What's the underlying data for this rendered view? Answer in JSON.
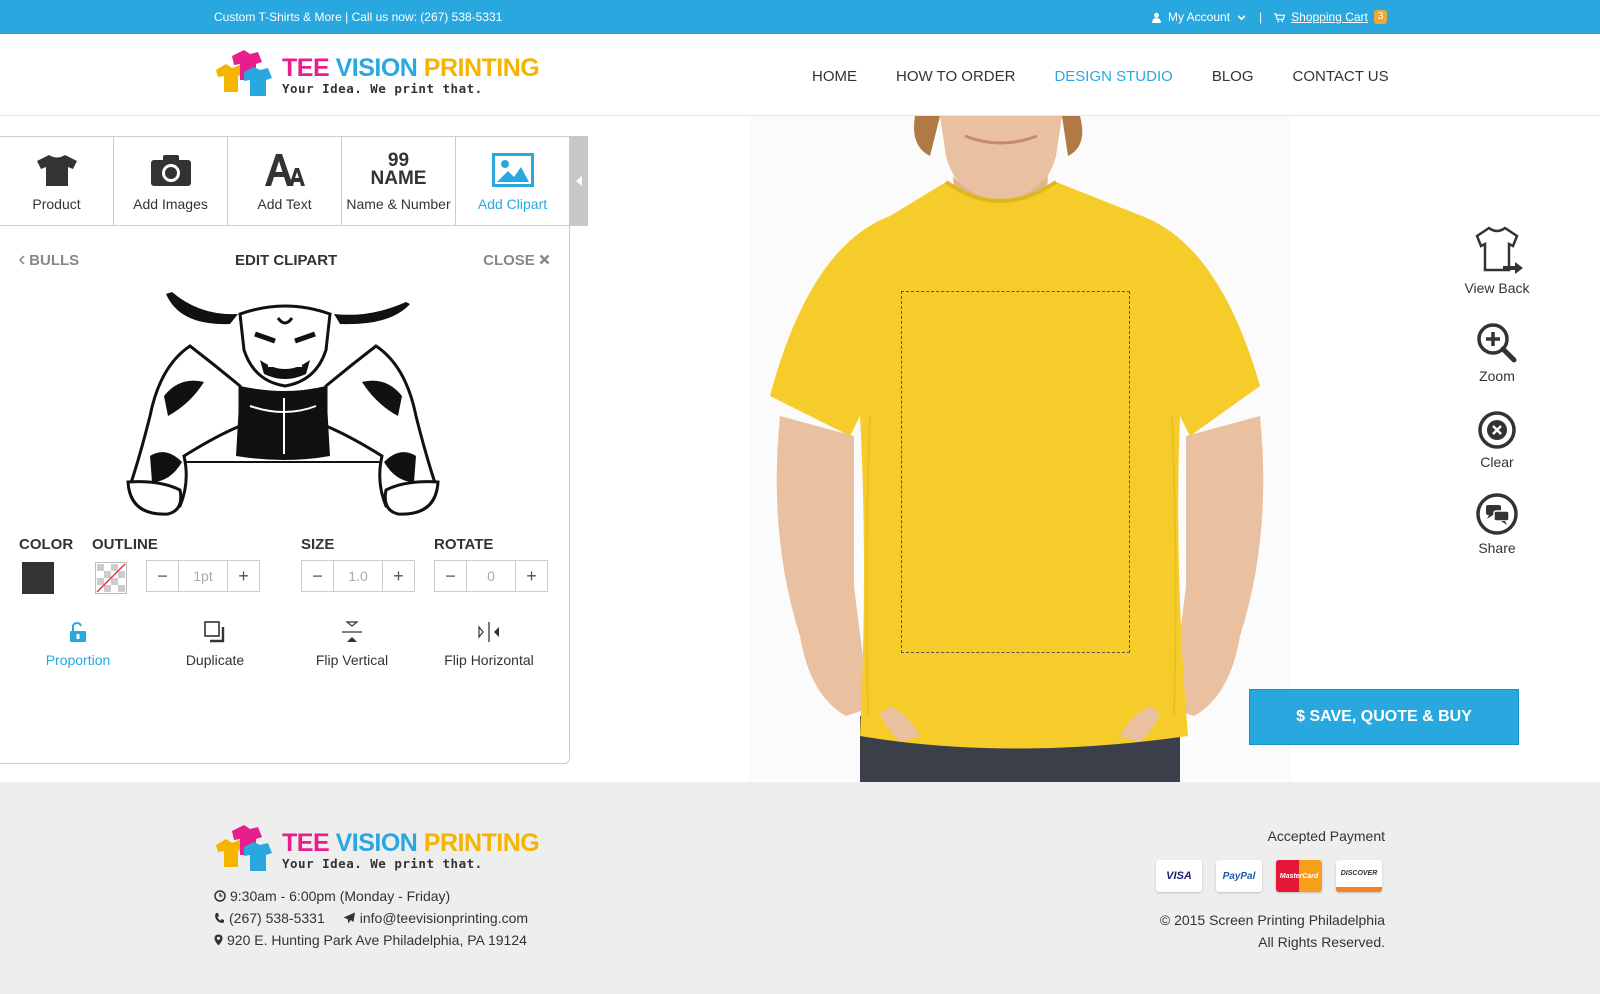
{
  "topbar": {
    "tagline": "Custom T-Shirts & More | Call us now: (267) 538-5331",
    "account": "My Account",
    "separator": "|",
    "cart": "Shopping Cart",
    "cart_count": "3"
  },
  "brand": {
    "tee": "TEE",
    "vision": "VISION",
    "printing": "PRINTING",
    "slogan": "Your Idea. We print that."
  },
  "nav": {
    "items": [
      "HOME",
      "HOW TO ORDER",
      "DESIGN STUDIO",
      "BLOG",
      "CONTACT US"
    ],
    "active": "DESIGN STUDIO"
  },
  "tools": {
    "product": "Product",
    "add_images": "Add Images",
    "add_text": "Add Text",
    "name_number": "Name & Number",
    "name_icon_number": "99",
    "name_icon_word": "NAME",
    "add_clipart": "Add Clipart"
  },
  "edit": {
    "back": "BULLS",
    "title": "EDIT CLIPART",
    "close": "CLOSE",
    "color_label": "COLOR",
    "color_value": "#333333",
    "outline_label": "OUTLINE",
    "outline_value": "1pt",
    "size_label": "SIZE",
    "size_value": "1.0",
    "rotate_label": "ROTATE",
    "rotate_value": "0",
    "actions": {
      "proportion": "Proportion",
      "duplicate": "Duplicate",
      "flip_vertical": "Flip Vertical",
      "flip_horizontal": "Flip Horizontal"
    }
  },
  "product": {
    "shirt_color": "#f5cc2a"
  },
  "side_tools": {
    "view_back": "View Back",
    "zoom": "Zoom",
    "clear": "Clear",
    "share": "Share"
  },
  "buy_button": "$ SAVE, QUOTE & BUY",
  "footer": {
    "hours": "9:30am - 6:00pm (Monday - Friday)",
    "phone": "(267) 538-5331",
    "email": "info@teevisionprinting.com",
    "address": "920 E. Hunting Park Ave Philadelphia, PA 19124",
    "accepted_payment": "Accepted Payment",
    "cards": [
      "VISA",
      "PayPal",
      "MasterCard",
      "DISCOVER"
    ],
    "copyright": "© 2015 Screen Printing Philadelphia",
    "rights": "All Rights Reserved."
  },
  "colors": {
    "accent": "#29a8e0",
    "brand_pink": "#e81e8c",
    "brand_yellow": "#f4b400",
    "footer_bg": "#eeeeee"
  }
}
